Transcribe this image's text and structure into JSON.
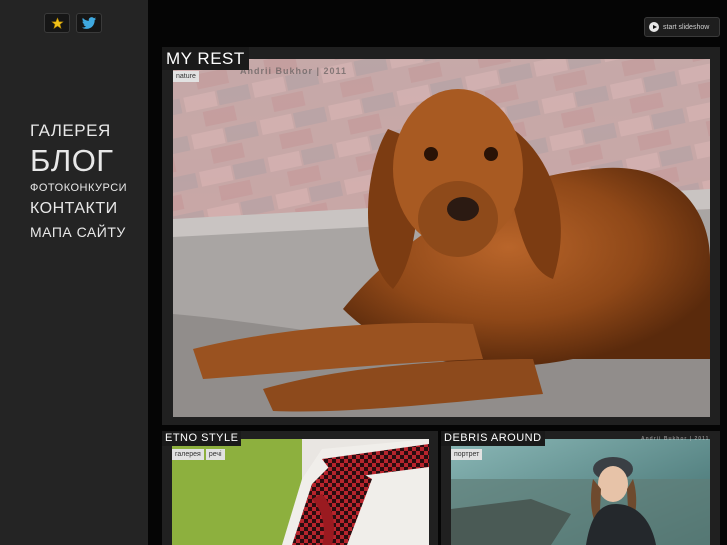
{
  "nav": {
    "items": [
      {
        "label": "ГАЛЕРЕЯ"
      },
      {
        "label": "БЛОГ"
      },
      {
        "label": "ФОТОКОНКУРСИ"
      },
      {
        "label": "КОНТАКТИ"
      },
      {
        "label": "МАПА САЙТУ"
      }
    ]
  },
  "toolbar": {
    "slideshow_label": "start slideshow"
  },
  "icons": {
    "favorite": "star-icon",
    "social": "twitter-bird-icon",
    "slideshow": "play-icon"
  },
  "colors": {
    "page_bg": "#050505",
    "sidebar_bg": "#242424",
    "panel_bg": "#202020",
    "tag_bg": "#e2e2e2",
    "star": "#f2c21a",
    "twitter": "#3fa9e0"
  },
  "posts": [
    {
      "title": "MY REST",
      "tags": [
        "nature"
      ],
      "watermark": "Andrii Bukhor | 2011"
    },
    {
      "title": "ETNO STYLE",
      "tags": [
        "галерея",
        "речі"
      ]
    },
    {
      "title": "DEBRIS AROUND",
      "tags": [
        "портрет"
      ],
      "watermark": "Andrii Bukhor | 2011"
    }
  ]
}
